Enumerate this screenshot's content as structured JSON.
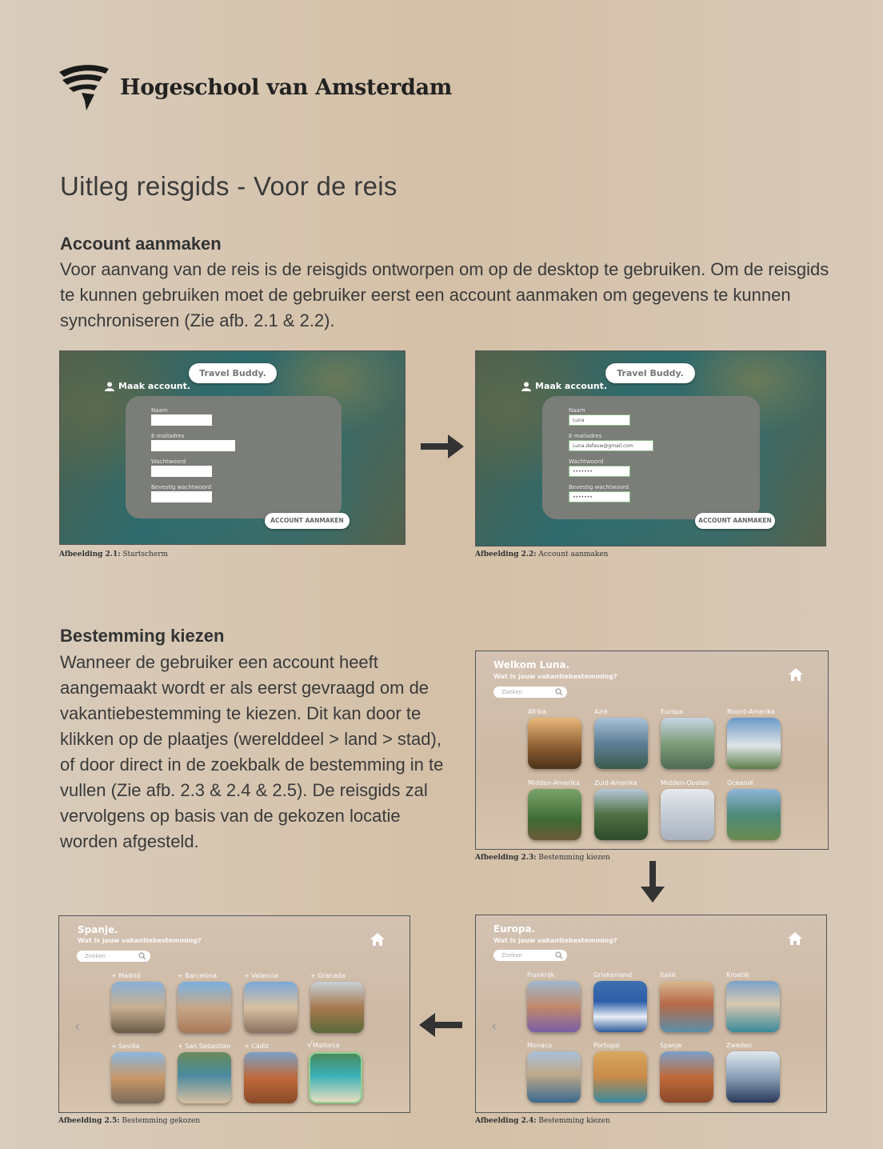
{
  "header": {
    "brand": "Hogeschool van Amsterdam",
    "title": "Uitleg reisgids - Voor de reis"
  },
  "account_section": {
    "heading": "Account aanmaken",
    "body": "Voor aanvang van de reis is de reisgids ontworpen om op de desktop te gebruiken. Om de reisgids te kunnen gebruiken moet de gebruiker eerst een account aanmaken om gegevens te kunnen synchroniseren (Zie afb. 2.1 & 2.2)."
  },
  "screen_21": {
    "app_name": "Travel Buddy.",
    "create_label": "Maak account.",
    "fields": [
      "Naam",
      "E-mailadres",
      "Wachtwoord",
      "Bevestig wachtwoord"
    ],
    "button": "ACCOUNT AANMAKEN",
    "caption_bold": "Afbeelding 2.1:",
    "caption_text": " Startscherm"
  },
  "screen_22": {
    "app_name": "Travel Buddy.",
    "create_label": "Maak account.",
    "fields": [
      "Naam",
      "E-mailadres",
      "Wachtwoord",
      "Bevestig wachtwoord"
    ],
    "values": [
      "Luna",
      "Luna.defauw@gmail.com",
      "•••••••",
      "•••••••"
    ],
    "button": "ACCOUNT AANMAKEN",
    "caption_bold": "Afbeelding 2.2:",
    "caption_text": " Account aanmaken"
  },
  "destination_section": {
    "heading": "Bestemming kiezen",
    "body": "Wanneer de gebruiker een account heeft aangemaakt wordt er als eerst gevraagd om de vakantiebestemming te kiezen. Dit kan door te klikken op de plaatjes (werelddeel > land > stad), of door direct in de zoekbalk de bestemming in te vullen (Zie afb. 2.3 & 2.4 & 2.5). De reisgids zal vervolgens op basis van de gekozen locatie worden afgesteld."
  },
  "screen_23": {
    "title": "Welkom Luna.",
    "subtitle": "Wat is jouw vakantiebestemming?",
    "search_placeholder": "Zoeken",
    "tiles": [
      "Afrika",
      "Azië",
      "Europa",
      "Noord-Amerika",
      "Midden-Amerika",
      "Zuid-Amerika",
      "Midden-Oosten",
      "Oceanië"
    ],
    "caption_bold": "Afbeelding 2.3:",
    "caption_text": " Bestemming kiezen"
  },
  "screen_24": {
    "title": "Europa.",
    "subtitle": "Wat is jouw vakantiebestemming?",
    "search_placeholder": "Zoeken",
    "tiles": [
      "Frankrijk",
      "Griekenland",
      "Italië",
      "Kroatië",
      "Monaco",
      "Portugal",
      "Spanje",
      "Zweden"
    ],
    "caption_bold": "Afbeelding 2.4:",
    "caption_text": " Bestemming kiezen"
  },
  "screen_25": {
    "title": "Spanje.",
    "subtitle": "Wat is jouw vakantiebestemming?",
    "search_placeholder": "Zoeken",
    "tiles": [
      "+ Madrid",
      "+ Barcelona",
      "+ Valencia",
      "+ Granada",
      "+ Sevilla",
      "+ San Sebastian",
      "+ Cádiz",
      "Mallorca"
    ],
    "selected_mark": "√",
    "caption_bold": "Afbeelding 2.5:",
    "caption_text": " Bestemming gekozen"
  },
  "colors": {
    "background": "#d4c0a6",
    "text": "#333333",
    "panel": "#7a7d78",
    "selected_border": "#8fd08f"
  },
  "icons": [
    "hva-logo-icon",
    "user-icon",
    "search-icon",
    "home-icon",
    "chevron-left-icon",
    "arrow-right-icon",
    "arrow-down-icon",
    "arrow-left-icon"
  ]
}
